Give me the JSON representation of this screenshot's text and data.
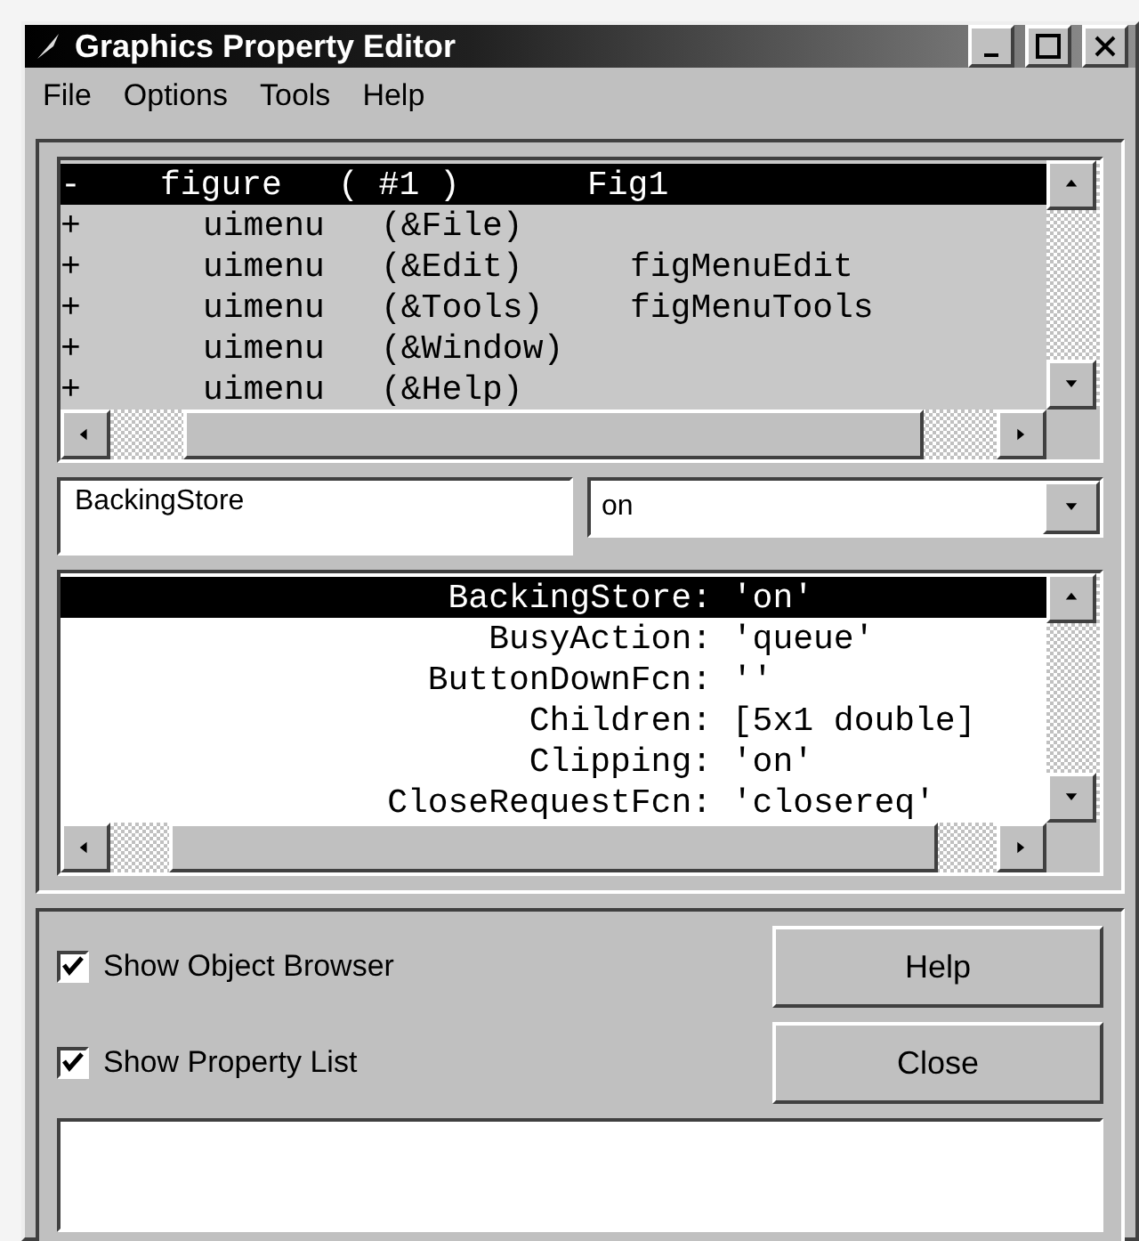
{
  "window": {
    "title": "Graphics Property Editor"
  },
  "menu": [
    "File",
    "Options",
    "Tools",
    "Help"
  ],
  "object_browser": {
    "items": [
      {
        "marker": "-",
        "type": "figure",
        "handle": "( #1 )",
        "tag": "Fig1",
        "selected": true,
        "children": [
          {
            "marker": "+",
            "type": "uimenu",
            "handle": "(&File)",
            "selected": false
          },
          {
            "marker": "+",
            "type": "uimenu",
            "handle": "(&Edit)",
            "tag": "figMenuEdit",
            "selected": false
          },
          {
            "marker": "+",
            "type": "uimenu",
            "handle": "(&Tools)",
            "tag": "figMenuTools",
            "selected": false
          },
          {
            "marker": "+",
            "type": "uimenu",
            "handle": "(&Window)",
            "selected": false
          },
          {
            "marker": "+",
            "type": "uimenu",
            "handle": "(&Help)",
            "selected": false
          }
        ]
      }
    ]
  },
  "property_field": {
    "value": "BackingStore"
  },
  "value_dropdown": {
    "value": "on"
  },
  "property_list": [
    {
      "name": "BackingStore:",
      "value": "'on'",
      "selected": true
    },
    {
      "name": "BusyAction:",
      "value": "'queue'",
      "selected": false
    },
    {
      "name": "ButtonDownFcn:",
      "value": "''",
      "selected": false
    },
    {
      "name": "Children:",
      "value": "[5x1 double]",
      "selected": false
    },
    {
      "name": "Clipping:",
      "value": "'on'",
      "selected": false
    },
    {
      "name": "CloseRequestFcn:",
      "value": "'closereq'",
      "selected": false
    }
  ],
  "options": [
    {
      "label": "Show Object Browser",
      "checked": true
    },
    {
      "label": "Show Property List",
      "checked": true
    }
  ],
  "buttons": [
    "Help",
    "Close"
  ]
}
